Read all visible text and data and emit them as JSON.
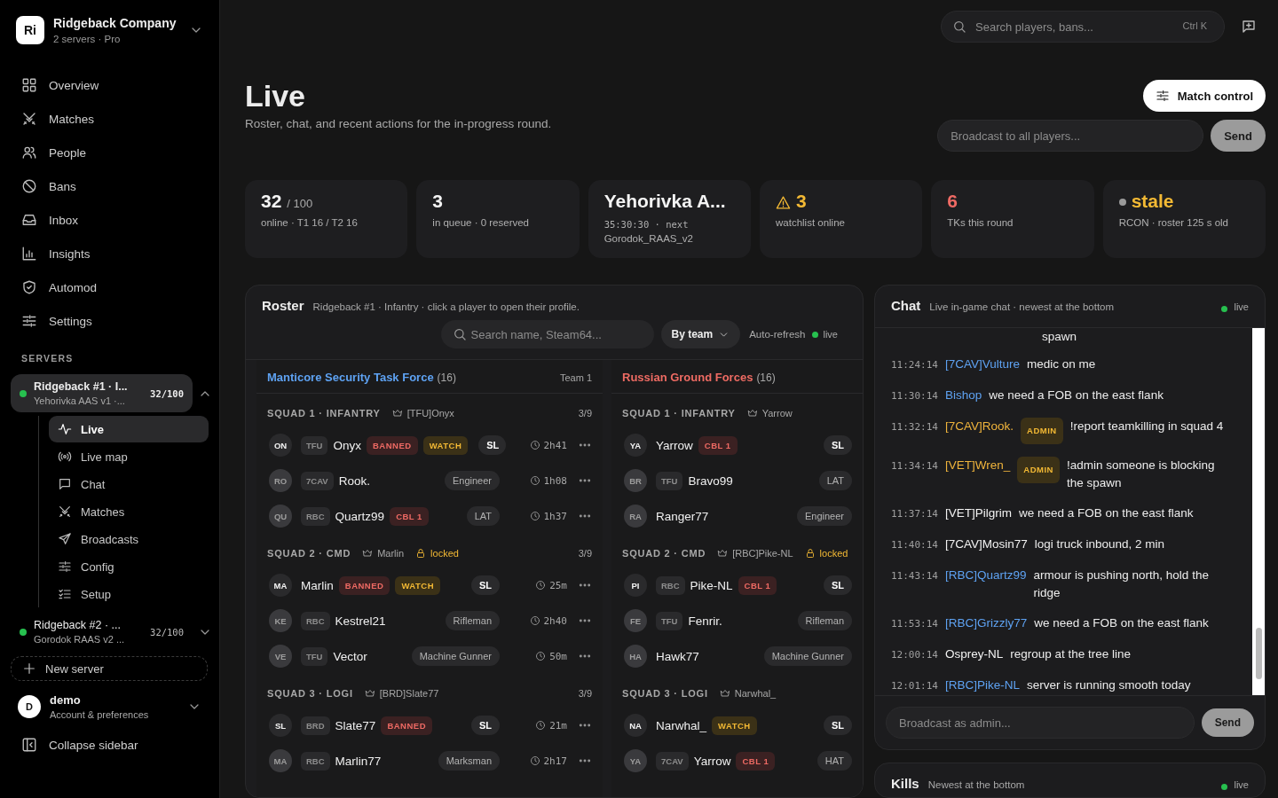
{
  "sidebar": {
    "org": {
      "initials": "Ri",
      "name": "Ridgeback Company",
      "sub": "2 servers · Pro"
    },
    "nav": [
      {
        "label": "Overview"
      },
      {
        "label": "Matches"
      },
      {
        "label": "People"
      },
      {
        "label": "Bans"
      },
      {
        "label": "Inbox"
      },
      {
        "label": "Insights"
      },
      {
        "label": "Automod"
      },
      {
        "label": "Settings"
      }
    ],
    "servers_heading": "SERVERS",
    "servers": [
      {
        "name": "Ridgeback #1 · I...",
        "map": "Yehorivka AAS v1 ·...",
        "players": "32/100",
        "online": true,
        "selected": true,
        "expanded": true,
        "children": [
          {
            "label": "Live",
            "selected": true
          },
          {
            "label": "Live map",
            "selected": false
          },
          {
            "label": "Chat",
            "selected": false
          },
          {
            "label": "Matches",
            "selected": false
          },
          {
            "label": "Broadcasts",
            "selected": false
          },
          {
            "label": "Config",
            "selected": false
          },
          {
            "label": "Setup",
            "selected": false
          }
        ]
      },
      {
        "name": "Ridgeback #2 · ...",
        "map": "Gorodok RAAS v2 ...",
        "players": "32/100",
        "online": true,
        "selected": false,
        "expanded": false
      }
    ],
    "new_server": "New server",
    "account": {
      "initial": "D",
      "name": "demo",
      "sub": "Account & preferences"
    },
    "collapse": "Collapse sidebar"
  },
  "topbar": {
    "search": {
      "placeholder": "Search players, bans...",
      "shortcut": "Ctrl K"
    }
  },
  "page": {
    "title": "Live",
    "subtitle": "Roster, chat, and recent actions for the in-progress round.",
    "match_control": "Match control",
    "broadcast": {
      "placeholder": "Broadcast to all players...",
      "button": "Send"
    }
  },
  "stats": [
    {
      "kind": "plain",
      "value": "32",
      "suffix": "/ 100",
      "lines": [
        "online · T1 16 / T2 16"
      ]
    },
    {
      "kind": "plain",
      "value": "3",
      "lines": [
        "in queue · 0 reserved"
      ]
    },
    {
      "kind": "map",
      "value": "Yehorivka A...",
      "lines": [
        "35:30:30 · next",
        "Gorodok_RAAS_v2"
      ]
    },
    {
      "kind": "watch",
      "value": "3",
      "lines": [
        "watchlist online"
      ]
    },
    {
      "kind": "danger",
      "value": "6",
      "lines": [
        "TKs this round"
      ]
    },
    {
      "kind": "stale",
      "value": "stale",
      "lines": [
        "RCON · roster 125 s old"
      ]
    }
  ],
  "roster": {
    "title": "Roster",
    "subtitle": "Ridgeback #1 · Infantry · click a player to open their profile.",
    "search": {
      "placeholder": "Search name, Steam64..."
    },
    "group_by": "By team",
    "auto_refresh": "Auto-refresh",
    "status": "live",
    "teams": [
      {
        "name": "Manticore Security Task Force",
        "count": "(16)",
        "label": "Team 1",
        "color": "#5ea2f2",
        "squads": [
          {
            "name": "SQUAD 1 · INFANTRY",
            "leader": "[TFU]Onyx",
            "locked": false,
            "count": "3/9",
            "players": [
              {
                "initials": "ON",
                "leader": true,
                "clan": "TFU",
                "name": "Onyx",
                "badges": [
                  {
                    "kind": "banned",
                    "label": "BANNED"
                  },
                  {
                    "kind": "watch",
                    "label": "WATCH"
                  }
                ],
                "role": "SL",
                "time": "2h41"
              },
              {
                "initials": "RO",
                "leader": false,
                "clan": "7CAV",
                "name": "Rook.",
                "role": "Engineer",
                "time": "1h08"
              },
              {
                "initials": "QU",
                "leader": false,
                "clan": "RBC",
                "name": "Quartz99",
                "badges": [
                  {
                    "kind": "cbl",
                    "label": "CBL 1"
                  }
                ],
                "role": "LAT",
                "time": "1h37"
              }
            ]
          },
          {
            "name": "SQUAD 2 · CMD",
            "leader": "Marlin",
            "locked": true,
            "locked_label": "locked",
            "count": "3/9",
            "players": [
              {
                "initials": "MA",
                "leader": true,
                "name": "Marlin",
                "badges": [
                  {
                    "kind": "banned",
                    "label": "BANNED"
                  },
                  {
                    "kind": "watch",
                    "label": "WATCH"
                  }
                ],
                "role": "SL",
                "time": "25m"
              },
              {
                "initials": "KE",
                "leader": false,
                "clan": "RBC",
                "name": "Kestrel21",
                "role": "Rifleman",
                "time": "2h40"
              },
              {
                "initials": "VE",
                "leader": false,
                "clan": "TFU",
                "name": "Vector",
                "role": "Machine Gunner",
                "time": "50m"
              }
            ]
          },
          {
            "name": "SQUAD 3 · LOGI",
            "leader": "[BRD]Slate77",
            "locked": false,
            "count": "3/9",
            "players": [
              {
                "initials": "SL",
                "leader": true,
                "clan": "BRD",
                "name": "Slate77",
                "badges": [
                  {
                    "kind": "banned",
                    "label": "BANNED"
                  }
                ],
                "role": "SL",
                "time": "21m"
              },
              {
                "initials": "MA",
                "leader": false,
                "clan": "RBC",
                "name": "Marlin77",
                "role": "Marksman",
                "time": "2h17"
              }
            ]
          }
        ]
      },
      {
        "name": "Russian Ground Forces",
        "count": "(16)",
        "color": "#ee6b63",
        "squads": [
          {
            "name": "SQUAD 1 · INFANTRY",
            "leader": "Yarrow",
            "locked": false,
            "players": [
              {
                "initials": "YA",
                "leader": true,
                "name": "Yarrow",
                "badges": [
                  {
                    "kind": "cbl",
                    "label": "CBL 1"
                  }
                ],
                "role": "SL"
              },
              {
                "initials": "BR",
                "leader": false,
                "clan": "TFU",
                "name": "Bravo99",
                "role": "LAT"
              },
              {
                "initials": "RA",
                "leader": false,
                "name": "Ranger77",
                "role": "Engineer"
              }
            ]
          },
          {
            "name": "SQUAD 2 · CMD",
            "leader": "[RBC]Pike-NL",
            "locked": true,
            "locked_label": "locked",
            "players": [
              {
                "initials": "PI",
                "leader": true,
                "clan": "RBC",
                "name": "Pike-NL",
                "badges": [
                  {
                    "kind": "cbl",
                    "label": "CBL 1"
                  }
                ],
                "role": "SL"
              },
              {
                "initials": "FE",
                "leader": false,
                "clan": "TFU",
                "name": "Fenrir.",
                "role": "Rifleman"
              },
              {
                "initials": "HA",
                "leader": false,
                "name": "Hawk77",
                "role": "Machine Gunner"
              }
            ]
          },
          {
            "name": "SQUAD 3 · LOGI",
            "leader": "Narwhal_",
            "locked": false,
            "players": [
              {
                "initials": "NA",
                "leader": true,
                "name": "Narwhal_",
                "badges": [
                  {
                    "kind": "watch",
                    "label": "WATCH"
                  }
                ],
                "role": "SL"
              },
              {
                "initials": "YA",
                "leader": false,
                "clan": "7CAV",
                "name": "Yarrow",
                "badges": [
                  {
                    "kind": "cbl",
                    "label": "CBL 1"
                  }
                ],
                "role": "HAT"
              }
            ]
          }
        ]
      }
    ]
  },
  "chat": {
    "title": "Chat",
    "subtitle": "Live in-game chat · newest at the bottom",
    "status": "live",
    "messages": [
      {
        "kind": "continued",
        "text": "spawn"
      },
      {
        "kind": "message",
        "time": "11:24:14",
        "author": "[7CAV]Vulture",
        "color": "#5ea2f2",
        "text": "medic on me"
      },
      {
        "kind": "message",
        "time": "11:30:14",
        "author": "Bishop",
        "color": "#5ea2f2",
        "text": "we need a FOB on the east flank"
      },
      {
        "kind": "message",
        "time": "11:32:14",
        "author": "[7CAV]Rook.",
        "color": "#f0b43c",
        "badge": "ADMIN",
        "text": "!report teamkilling in squad 4"
      },
      {
        "kind": "message",
        "time": "11:34:14",
        "author": "[VET]Wren_",
        "color": "#f0b43c",
        "badge": "ADMIN",
        "text": "!admin someone is blocking the spawn"
      },
      {
        "kind": "message",
        "time": "11:37:14",
        "author": "[VET]Pilgrim",
        "color": "#f2f2f2",
        "text": "we need a FOB on the east flank"
      },
      {
        "kind": "message",
        "time": "11:40:14",
        "author": "[7CAV]Mosin77",
        "color": "#f2f2f2",
        "text": "logi truck inbound, 2 min"
      },
      {
        "kind": "message",
        "time": "11:43:14",
        "author": "[RBC]Quartz99",
        "color": "#5ea2f2",
        "text": "armour is pushing north, hold the ridge"
      },
      {
        "kind": "message",
        "time": "11:53:14",
        "author": "[RBC]Grizzly77",
        "color": "#5ea2f2",
        "text": "we need a FOB on the east flank"
      },
      {
        "kind": "message",
        "time": "12:00:14",
        "author": "Osprey-NL",
        "color": "#f2f2f2",
        "text": "regroup at the tree line"
      },
      {
        "kind": "message",
        "time": "12:01:14",
        "author": "[RBC]Pike-NL",
        "color": "#5ea2f2",
        "text": "server is running smooth today"
      }
    ],
    "input": {
      "placeholder": "Broadcast as admin..."
    },
    "send": "Send"
  },
  "kills": {
    "title": "Kills",
    "subtitle": "Newest at the bottom",
    "status": "live"
  }
}
